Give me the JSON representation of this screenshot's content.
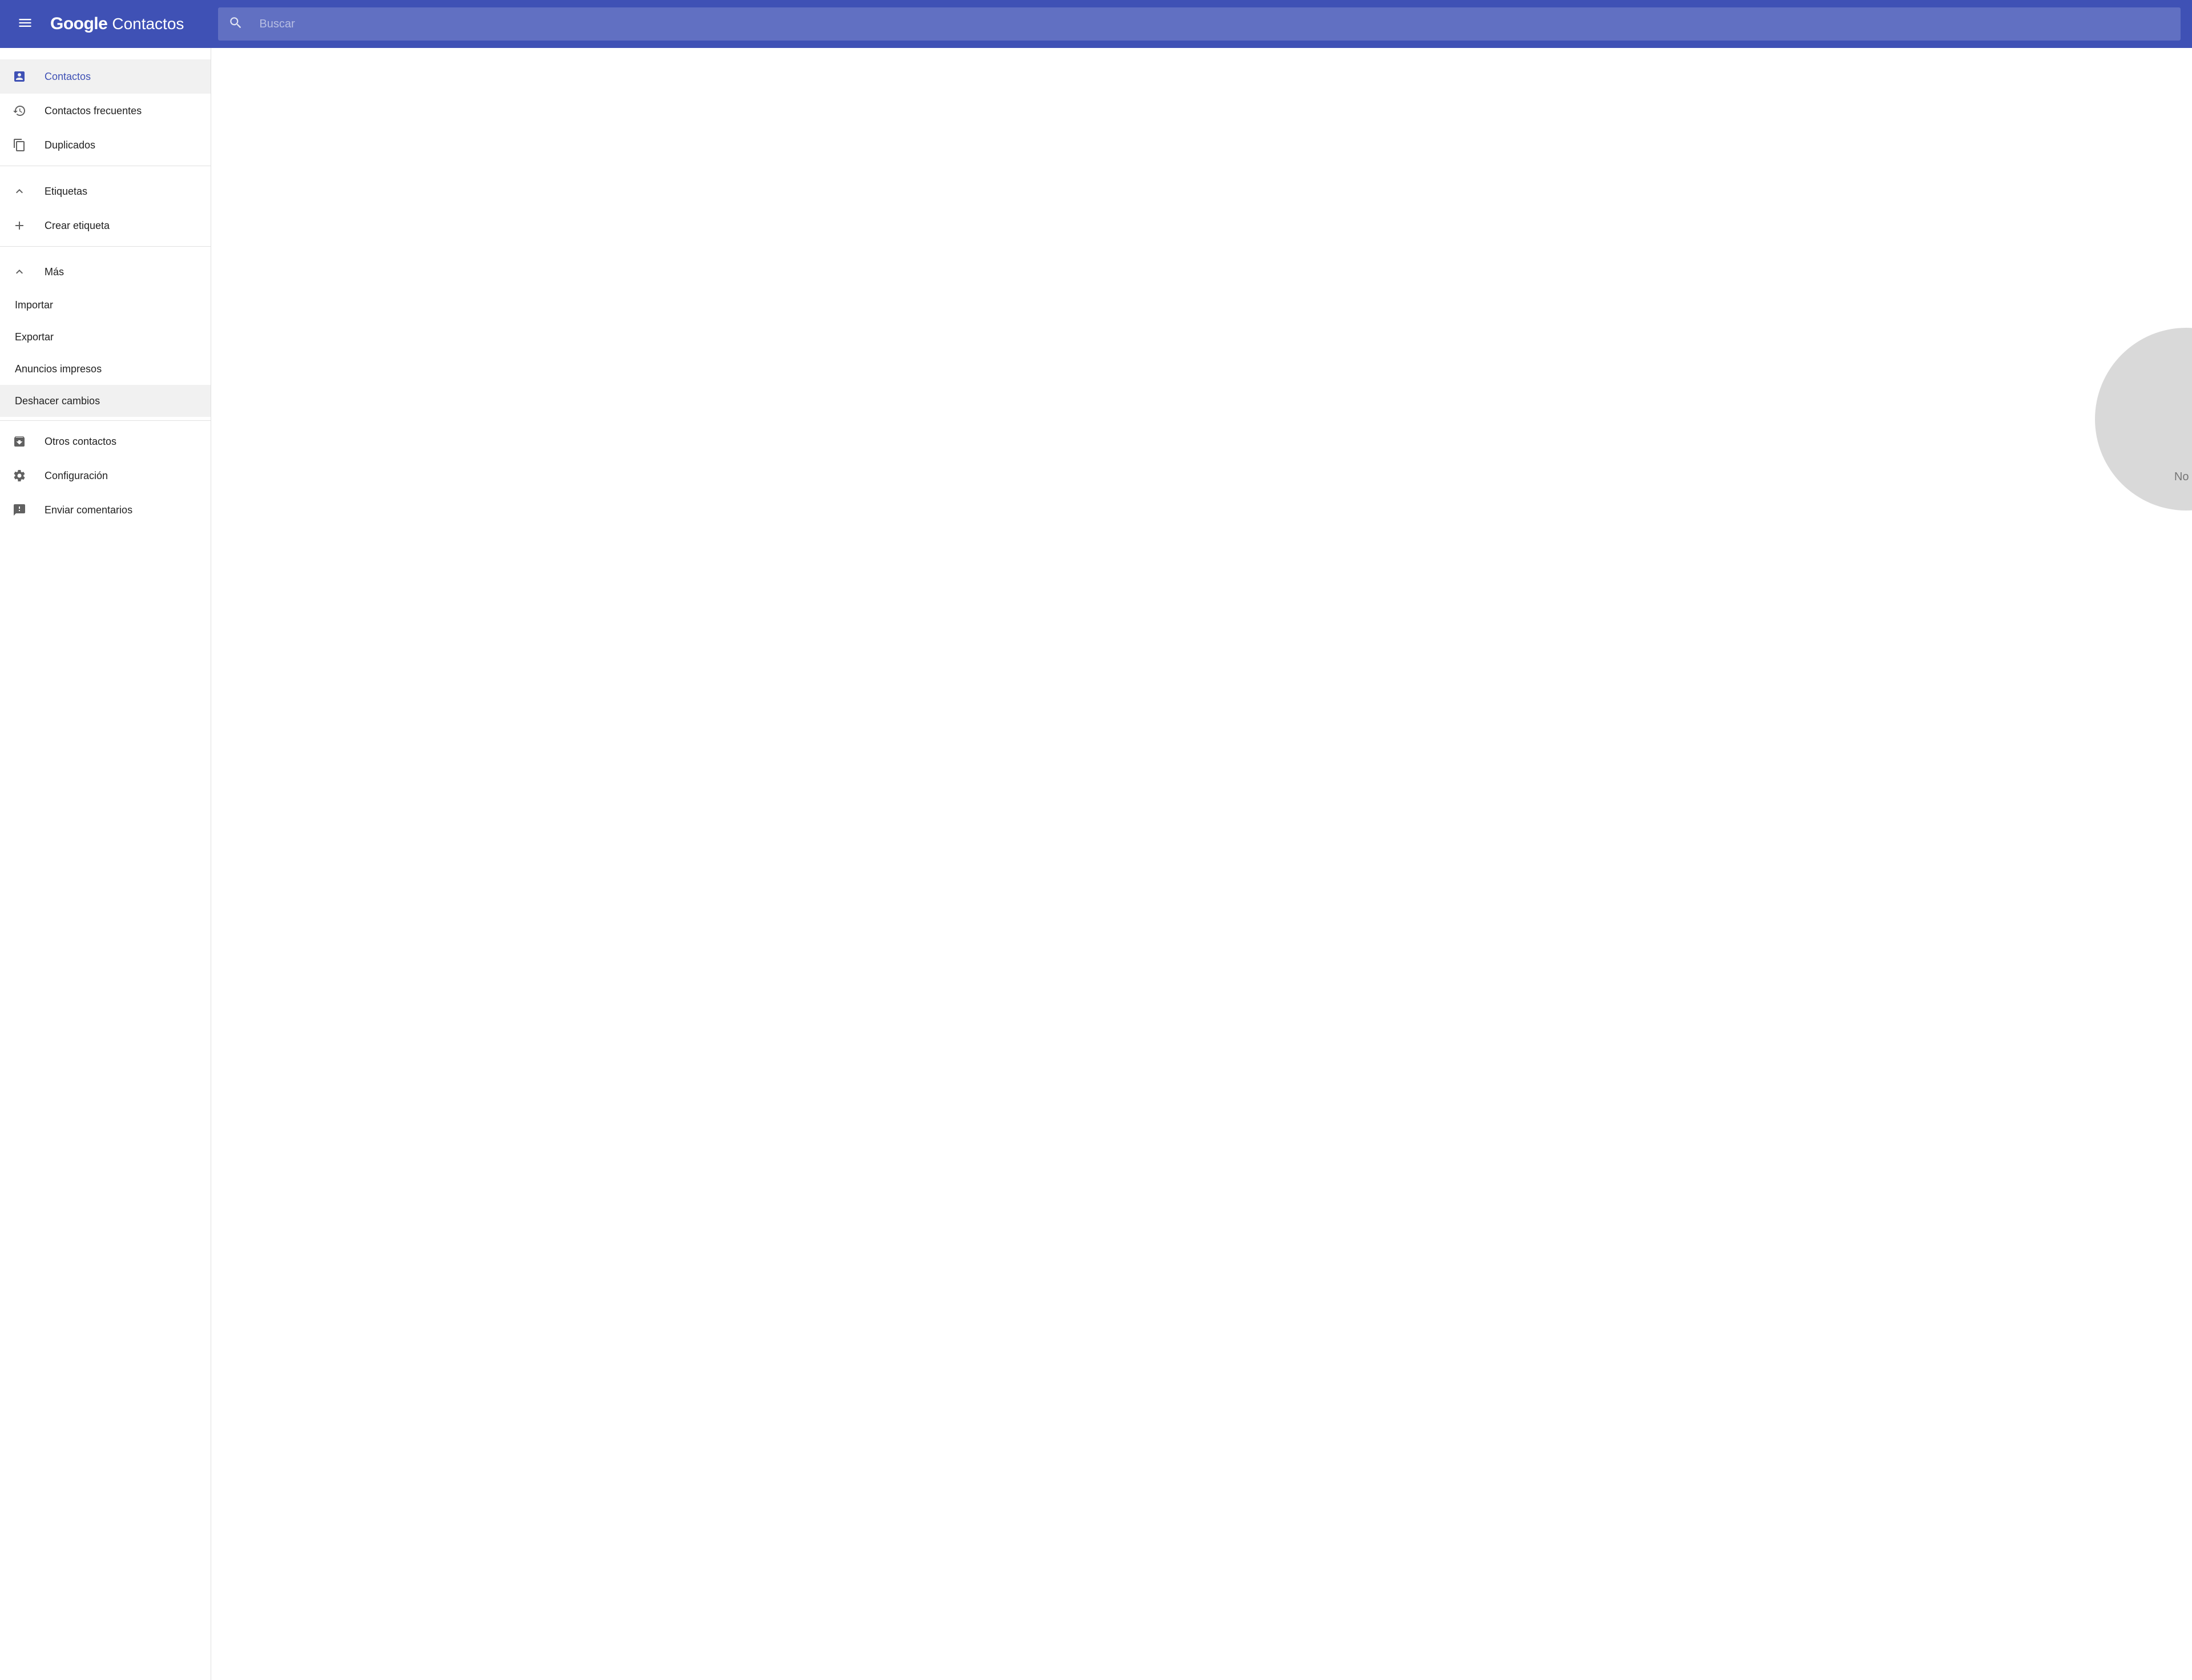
{
  "header": {
    "logo_brand": "Google",
    "logo_app": "Contactos",
    "search_placeholder": "Buscar"
  },
  "sidebar": {
    "primary": [
      {
        "key": "contacts",
        "label": "Contactos",
        "icon": "contact",
        "active": true
      },
      {
        "key": "frequent",
        "label": "Contactos frecuentes",
        "icon": "history",
        "active": false
      },
      {
        "key": "dupes",
        "label": "Duplicados",
        "icon": "copy",
        "active": false
      }
    ],
    "labels_header": "Etiquetas",
    "create_label": "Crear etiqueta",
    "more_header": "Más",
    "more_items": [
      {
        "key": "import",
        "label": "Importar"
      },
      {
        "key": "export",
        "label": "Exportar"
      },
      {
        "key": "print",
        "label": "Anuncios impresos"
      },
      {
        "key": "undo",
        "label": "Deshacer cambios",
        "hover": true
      }
    ],
    "footer": [
      {
        "key": "other",
        "label": "Otros contactos",
        "icon": "archive"
      },
      {
        "key": "settings",
        "label": "Configuración",
        "icon": "gear"
      },
      {
        "key": "feedback",
        "label": "Enviar comentarios",
        "icon": "feedback"
      }
    ]
  },
  "main": {
    "empty_text": "No ti"
  }
}
